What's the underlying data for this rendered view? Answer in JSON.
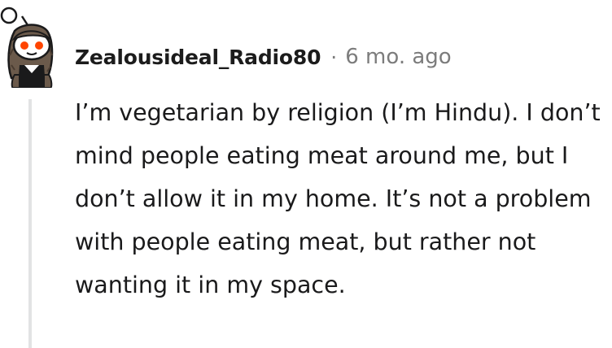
{
  "comment": {
    "author": "Zealousideal_Radio80",
    "separator": "·",
    "timestamp": "6 mo. ago",
    "body": "I’m vegetarian by religion (I’m Hindu). I don’t mind people eating meat around me, but I don’t allow it in my home. It’s not a problem with people eating meat, but rather not wanting it in my space.",
    "avatar_icon": "snoo-avatar-icon"
  },
  "colors": {
    "text": "#1a1a1b",
    "meta": "#7c7c7c",
    "thread_line": "#e2e3e4",
    "avatar_orange": "#ff4500",
    "avatar_hair": "#6b5a4b"
  }
}
